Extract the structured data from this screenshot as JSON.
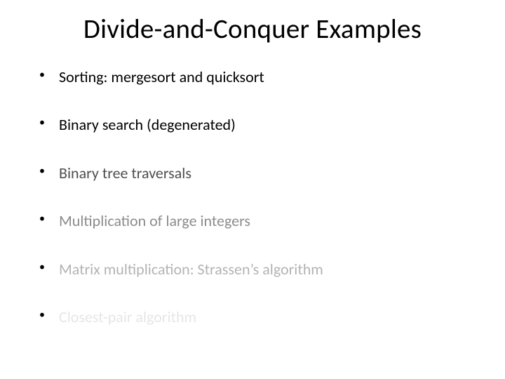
{
  "title": "Divide-and-Conquer Examples",
  "bullets": [
    "Sorting: mergesort and quicksort",
    "Binary search (degenerated)",
    "Binary tree traversals",
    "Multiplication of large integers",
    "Matrix multiplication: Strassen’s algorithm",
    "Closest-pair algorithm"
  ]
}
